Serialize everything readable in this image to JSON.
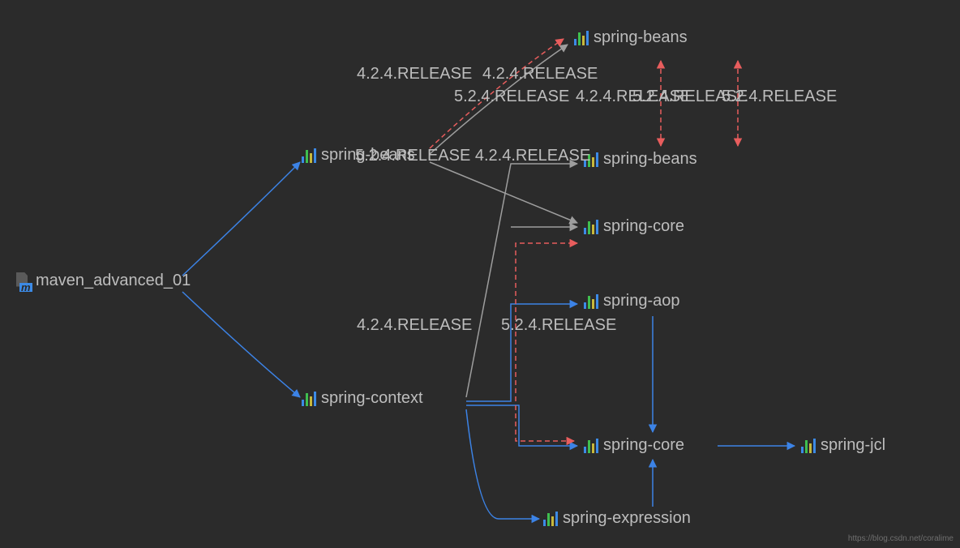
{
  "root": {
    "label": "maven_advanced_01"
  },
  "nodes": {
    "spring_beans_left": "spring-beans",
    "spring_context": "spring-context",
    "spring_beans_top": "spring-beans",
    "spring_beans_mid": "spring-beans",
    "spring_core_mid": "spring-core",
    "spring_aop": "spring-aop",
    "spring_core_low": "spring-core",
    "spring_expression": "spring-expression",
    "spring_jcl": "spring-jcl"
  },
  "versions": {
    "label_4_2_4_left": "4.2.4.RELEASE",
    "label_4_2_4_a": "4.2.4.RELEASE",
    "label_5_2_4_a": "5.2.4.RELEASE",
    "label_5_2_4_b": "5.2.4.RELEASE",
    "label_4_2_4_b": "4.2.4.RELEASE",
    "label_5_2_4_c": "5.2.4.RELEASE",
    "label_overlap_mid": "5.2.4.RELEASE   4.2.4.RELEASE",
    "label_bottom_left": "4.2.4.RELEASE",
    "label_bottom_right": "5.2.4.RELEASE"
  },
  "watermark": "https://blog.csdn.net/coralime"
}
